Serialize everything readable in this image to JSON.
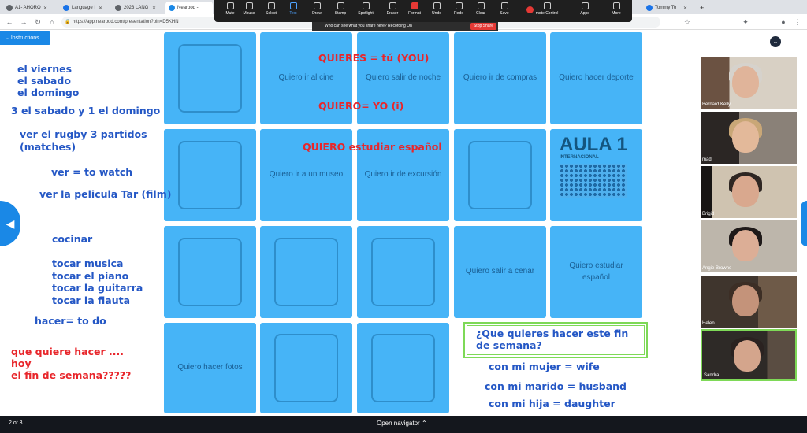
{
  "browser": {
    "tabs": [
      {
        "title": "A1- AHORO"
      },
      {
        "title": "Language I"
      },
      {
        "title": "2023 LANG"
      },
      {
        "title": "Nearpod -",
        "active": true
      },
      {
        "title": "Tommy To"
      }
    ],
    "new_tab": "+",
    "url": "https://app.nearpod.com/presentation?pin=D5KHN"
  },
  "zoom_toolbar": {
    "items": [
      "Mute",
      "Mouse",
      "Select",
      "Text",
      "Draw",
      "Stamp",
      "Spotlight",
      "Eraser",
      "Format",
      "Undo",
      "Redo",
      "Clear",
      "Save"
    ],
    "right_items": [
      "mote Control",
      "Apps",
      "More"
    ],
    "share_notice": "Who can see what you share here? Recording On",
    "stop_share": "Stop Share"
  },
  "nearpod": {
    "instructions": "Instructions",
    "page_counter": "2 of 3",
    "open_navigator": "Open navigator",
    "grid": {
      "r1": [
        "",
        "Quiero ir al cine",
        "Quiero salir de noche",
        "Quiero ir de compras",
        "Quiero hacer deporte"
      ],
      "r2": [
        "",
        "Quiero ir a un museo",
        "Quiero ir de excursión",
        "",
        ""
      ],
      "r3": [
        "",
        "",
        "",
        "Quiero salir a cenar",
        "Quiero estudiar español"
      ],
      "r4": [
        "Quiero hacer fotos",
        "",
        ""
      ],
      "aula_title": "AULA",
      "aula_number": "1",
      "aula_subtitle": "INTERNACIONAL"
    }
  },
  "annotations": {
    "left": [
      {
        "text": "el viernes",
        "color": "#2457c5"
      },
      {
        "text": "el sabado",
        "color": "#2457c5"
      },
      {
        "text": "el domingo",
        "color": "#2457c5"
      },
      {
        "text": "3 el sabado y 1 el domingo",
        "color": "#2457c5"
      },
      {
        "text": "ver el rugby 3 partidos",
        "color": "#2457c5"
      },
      {
        "text": "(matches)",
        "color": "#2457c5"
      },
      {
        "text": "ver = to watch",
        "color": "#2457c5"
      },
      {
        "text": "ver la pelicula Tar (film)",
        "color": "#2457c5"
      },
      {
        "text": "cocinar",
        "color": "#2457c5"
      },
      {
        "text": "tocar musica",
        "color": "#2457c5"
      },
      {
        "text": "tocar el piano",
        "color": "#2457c5"
      },
      {
        "text": "tocar la guitarra",
        "color": "#2457c5"
      },
      {
        "text": "tocar la flauta",
        "color": "#2457c5"
      },
      {
        "text": "hacer= to do",
        "color": "#2457c5"
      },
      {
        "text": "que quiere hacer ....",
        "color": "#e8262b"
      },
      {
        "text": "hoy",
        "color": "#e8262b"
      },
      {
        "text": "el fin de semana?????",
        "color": "#e8262b"
      }
    ],
    "center": [
      {
        "text": "QUIERES = tú (YOU)",
        "color": "#e8262b"
      },
      {
        "text": "QUIERO= YO  (i)",
        "color": "#e8262b"
      },
      {
        "text": "QUIERO estudiar español",
        "color": "#e8262b"
      }
    ],
    "question": [
      "¿Que quieres hacer este fin",
      "de semana?"
    ],
    "answers": [
      "con mi mujer  = wife",
      "con mi marido = husband",
      "con mi hija = daughter"
    ]
  },
  "participants": [
    {
      "name": "Bernard Kelly"
    },
    {
      "name": "mad"
    },
    {
      "name": "Brigid"
    },
    {
      "name": "Angie Browne"
    },
    {
      "name": "Helen"
    },
    {
      "name": "Sandra"
    }
  ]
}
